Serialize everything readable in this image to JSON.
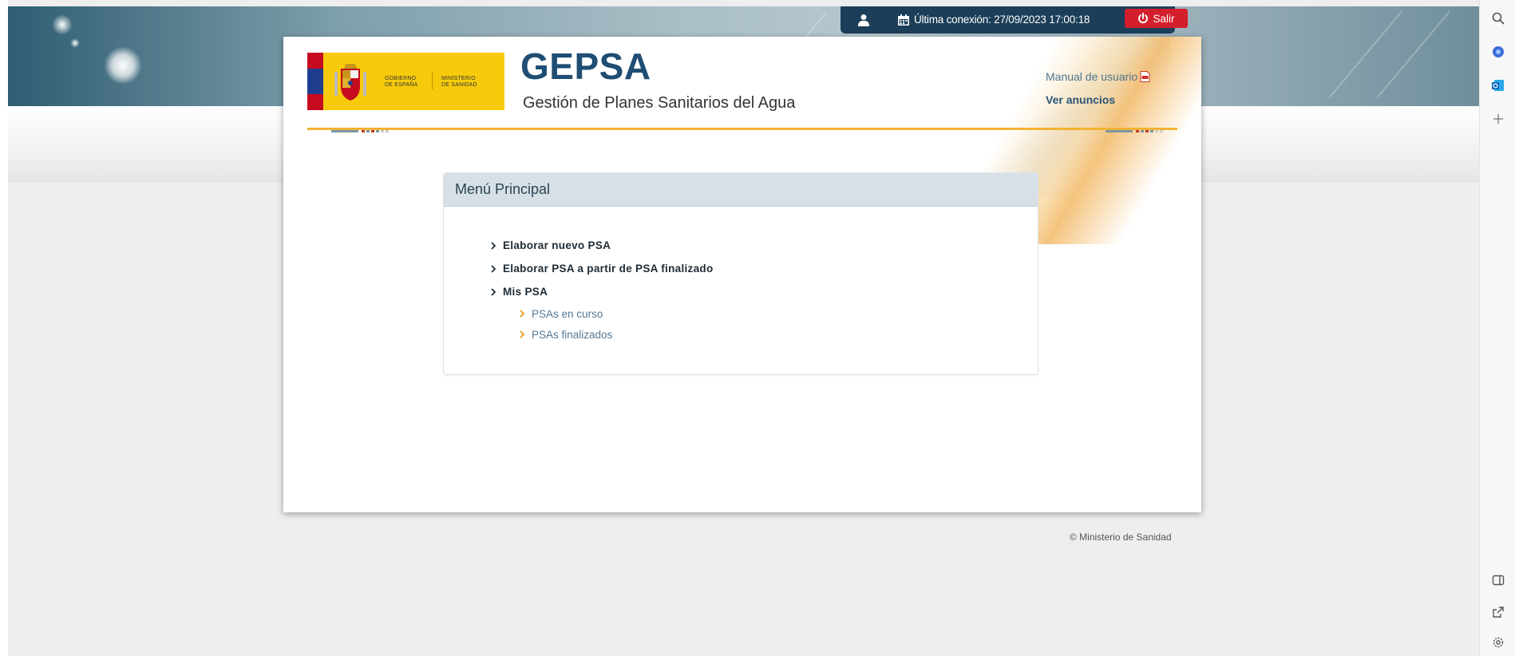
{
  "header": {
    "last_connection": "Última conexión: 27/09/2023 17:00:18",
    "logout_label": "Salir",
    "gov_text": "GOBIERNO\nDE ESPAÑA",
    "ministry_text": "MINISTERIO\nDE SANIDAD",
    "app_title": "GEPSA",
    "app_subtitle": "Gestión de Planes Sanitarios del Agua",
    "manual_link": "Manual de usuario",
    "announcements_link": "Ver anuncios"
  },
  "menu": {
    "title": "Menú Principal",
    "items": [
      {
        "label": "Elaborar nuevo PSA"
      },
      {
        "label": "Elaborar PSA a partir de PSA finalizado"
      },
      {
        "label": "Mis PSA"
      }
    ],
    "subitems": [
      {
        "label": "PSAs en curso"
      },
      {
        "label": "PSAs finalizados"
      }
    ]
  },
  "footer": {
    "copyright": "© Ministerio de Sanidad"
  },
  "colors": {
    "brand_blue": "#1f4d73",
    "accent_orange": "#f2b233",
    "logout_red": "#d31f2b",
    "topbar_navy": "#1c3e58"
  },
  "sidepanel": {
    "icons": [
      "search-icon",
      "copilot-icon",
      "outlook-icon",
      "add-icon",
      "sidebar-toggle-icon",
      "external-link-icon",
      "settings-icon"
    ]
  }
}
